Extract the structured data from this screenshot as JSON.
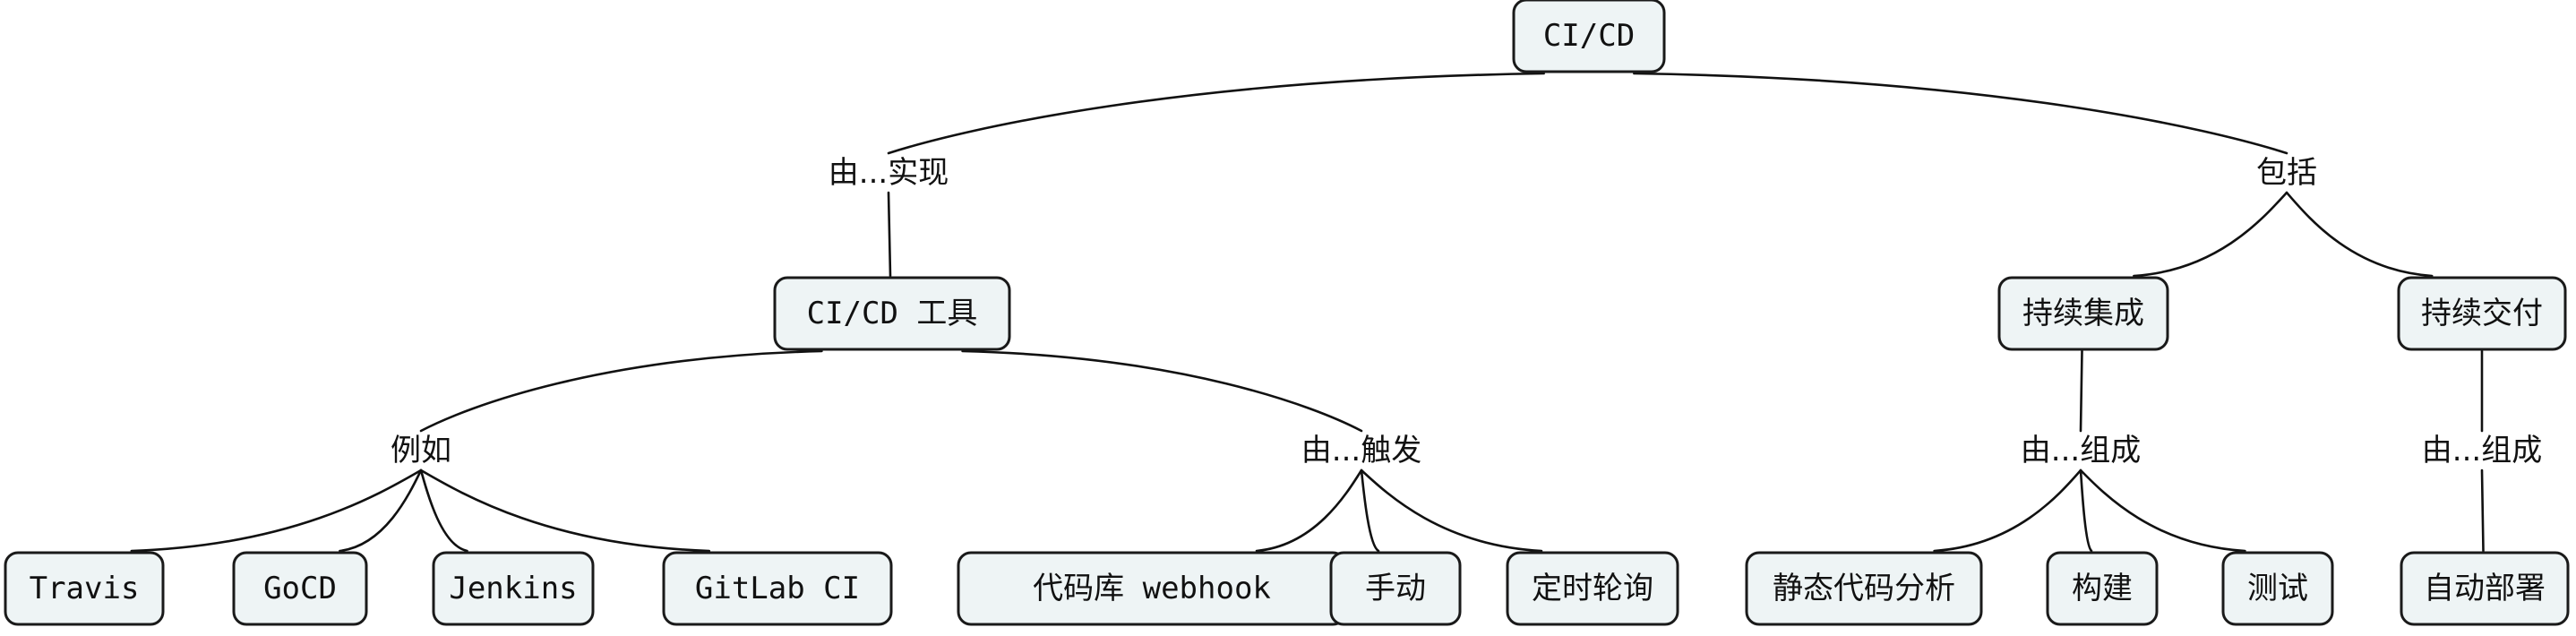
{
  "diagram": {
    "nodes": {
      "root": "CI/CD",
      "tools": "CI/CD 工具",
      "ci": "持续集成",
      "cd": "持续交付",
      "travis": "Travis",
      "gocd": "GoCD",
      "jenkins": "Jenkins",
      "gitlab": "GitLab CI",
      "webhook": "代码库 webhook",
      "manual": "手动",
      "timer": "定时轮询",
      "static": "静态代码分析",
      "build": "构建",
      "test": "测试",
      "deploy": "自动部署"
    },
    "labels": {
      "impl": "由...实现",
      "includes": "包括",
      "example": "例如",
      "trigger": "由...触发",
      "ci_compose": "由...组成",
      "cd_compose": "由...组成"
    },
    "edges": [
      [
        "root",
        "impl"
      ],
      [
        "impl",
        "tools"
      ],
      [
        "root",
        "includes"
      ],
      [
        "includes",
        "ci"
      ],
      [
        "includes",
        "cd"
      ],
      [
        "tools",
        "example"
      ],
      [
        "example",
        "travis"
      ],
      [
        "example",
        "gocd"
      ],
      [
        "example",
        "jenkins"
      ],
      [
        "example",
        "gitlab"
      ],
      [
        "tools",
        "trigger"
      ],
      [
        "trigger",
        "webhook"
      ],
      [
        "trigger",
        "manual"
      ],
      [
        "trigger",
        "timer"
      ],
      [
        "ci",
        "ci_compose"
      ],
      [
        "ci_compose",
        "static"
      ],
      [
        "ci_compose",
        "build"
      ],
      [
        "ci_compose",
        "test"
      ],
      [
        "cd",
        "cd_compose"
      ],
      [
        "cd_compose",
        "deploy"
      ]
    ]
  }
}
